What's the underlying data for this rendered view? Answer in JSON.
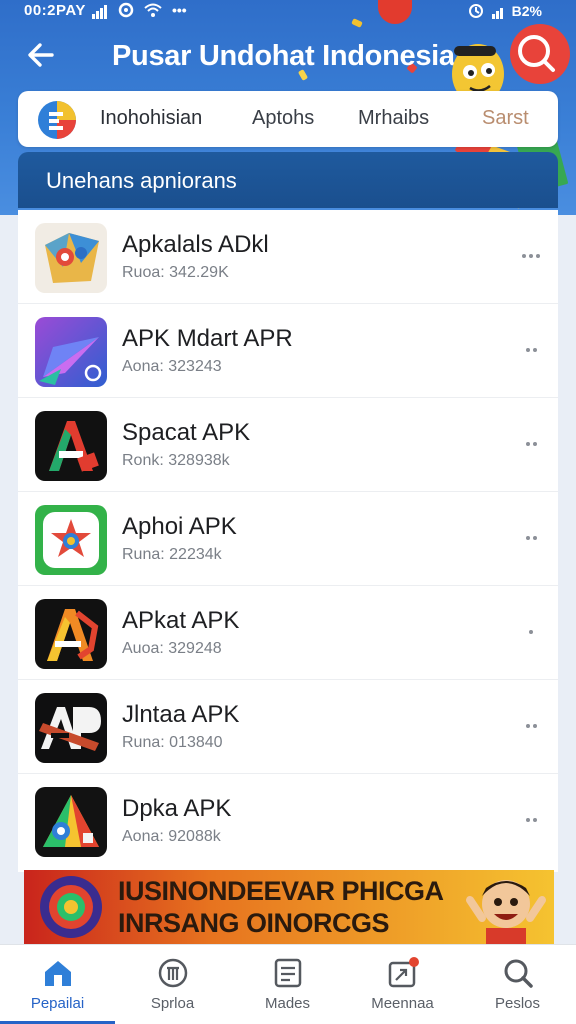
{
  "status_bar": {
    "time": "00:2PAY",
    "battery": "B2%"
  },
  "header": {
    "title": "Pusar Undohat Indonesia",
    "back_icon": "back-arrow-icon",
    "search_icon": "search-icon"
  },
  "tabs": [
    {
      "label": "Inohohisian",
      "state": "active"
    },
    {
      "label": "Aptohs",
      "state": "normal"
    },
    {
      "label": "Mrhaibs",
      "state": "normal"
    },
    {
      "label": "Sarst",
      "state": "faded"
    }
  ],
  "section": {
    "title": "Unehans apniorans"
  },
  "apps": [
    {
      "name": "Apkalals ADkl",
      "meta": "Ruoa: 342.29K",
      "icon": "map-pin-app-icon"
    },
    {
      "name": "APK Mdart APR",
      "meta": "Aona: 323243",
      "icon": "paper-plane-app-icon"
    },
    {
      "name": "Spacat APK",
      "meta": "Ronk: 328938k",
      "icon": "letter-a-app-icon"
    },
    {
      "name": "Aphoi APK",
      "meta": "Runa: 22234k",
      "icon": "star-logo-app-icon"
    },
    {
      "name": "APkat APK",
      "meta": "Auoa: 329248",
      "icon": "letter-a-orange-app-icon"
    },
    {
      "name": "Jlntaa APK",
      "meta": "Runa: 013840",
      "icon": "letters-ap-app-icon"
    },
    {
      "name": "Dpka APK",
      "meta": "Aona: 92088k",
      "icon": "triangle-app-icon"
    }
  ],
  "ad": {
    "line1": "IUSINONDEEVAR PHICGA",
    "line2": "INRSANG OINORCGS"
  },
  "nav": [
    {
      "label": "Pepailai",
      "icon": "home-icon",
      "active": true
    },
    {
      "label": "Sprloa",
      "icon": "store-icon",
      "active": false
    },
    {
      "label": "Mades",
      "icon": "document-icon",
      "active": false
    },
    {
      "label": "Meennaa",
      "icon": "notification-box-icon",
      "active": false
    },
    {
      "label": "Peslos",
      "icon": "search-icon",
      "active": false
    }
  ],
  "colors": {
    "header_blue": "#3a7fd6",
    "section_blue": "#1a4f8e",
    "accent_blue": "#2563c7",
    "ad_red": "#c9241c",
    "ad_yellow": "#f5c330"
  }
}
